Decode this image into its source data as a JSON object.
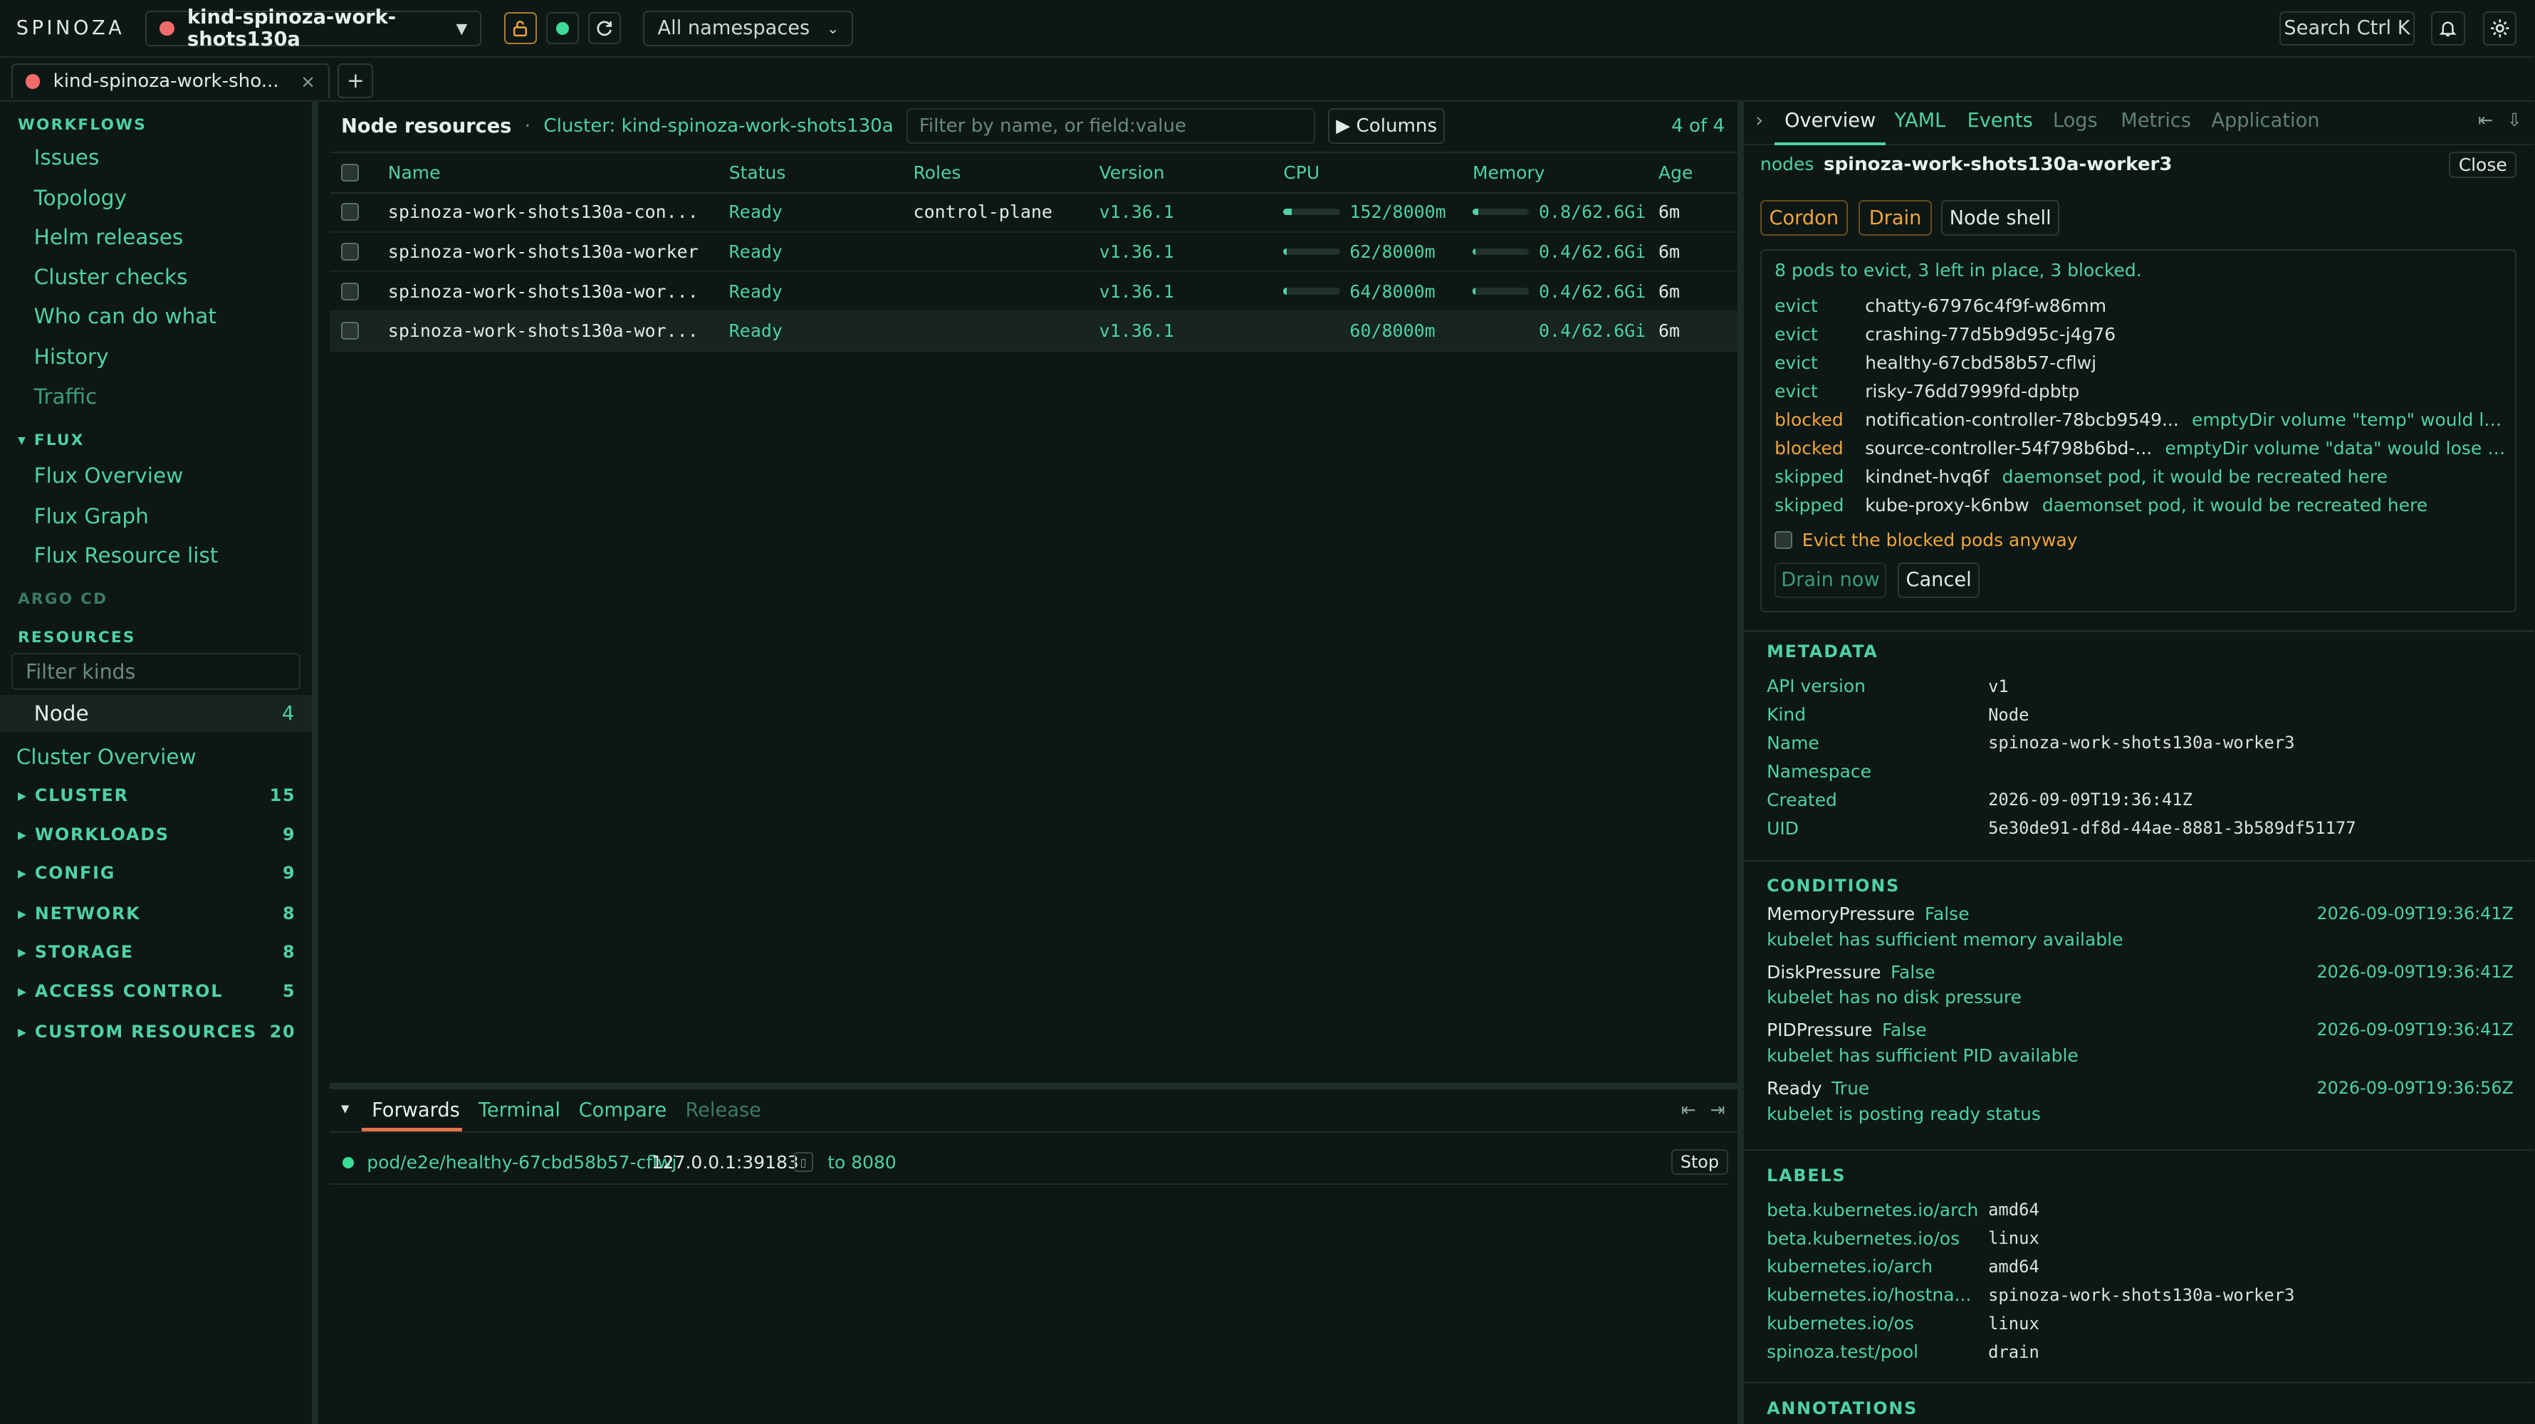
{
  "app": {
    "logo": "SPINOZA",
    "context": "kind-spinoza-work-shots130a",
    "namespace": "All namespaces",
    "search": "Search Ctrl K"
  },
  "tab": {
    "label": "kind-spinoza-work-sho...",
    "close": "×",
    "add": "+"
  },
  "sidebar": {
    "workflows_head": "WORKFLOWS",
    "workflows": [
      "Issues",
      "Topology",
      "Helm releases",
      "Cluster checks",
      "Who can do what",
      "History",
      "Traffic"
    ],
    "flux_head": "▾ FLUX",
    "flux": [
      "Flux Overview",
      "Flux Graph",
      "Flux Resource list"
    ],
    "argo_head": "ARGO CD",
    "resources_head": "RESOURCES",
    "filter_placeholder": "Filter kinds",
    "selected_kind": {
      "label": "Node",
      "count": "4"
    },
    "cluster_overview": "Cluster Overview",
    "groups": [
      {
        "label": "▸ CLUSTER",
        "count": "15"
      },
      {
        "label": "▸ WORKLOADS",
        "count": "9"
      },
      {
        "label": "▸ CONFIG",
        "count": "9"
      },
      {
        "label": "▸ NETWORK",
        "count": "8"
      },
      {
        "label": "▸ STORAGE",
        "count": "8"
      },
      {
        "label": "▸ ACCESS CONTROL",
        "count": "5"
      },
      {
        "label": "▸ CUSTOM RESOURCES",
        "count": "20"
      }
    ]
  },
  "main": {
    "title": "Node resources",
    "sep": "·",
    "cluster": "Cluster: kind-spinoza-work-shots130a",
    "filter_placeholder": "Filter by name, or field:value",
    "columns_btn": "▶ Columns",
    "count": "4 of 4",
    "headers": [
      "Name",
      "Status",
      "Roles",
      "Version",
      "CPU",
      "Memory",
      "Age"
    ],
    "rows": [
      {
        "name": "spinoza-work-shots130a-con...",
        "status": "Ready",
        "roles": "control-plane",
        "version": "v1.36.1",
        "cpu": "152/8000m",
        "cpu_frac": 0.019,
        "mem": "0.8/62.6Gi",
        "mem_frac": 0.013,
        "age": "6m"
      },
      {
        "name": "spinoza-work-shots130a-worker",
        "status": "Ready",
        "roles": "",
        "version": "v1.36.1",
        "cpu": "62/8000m",
        "cpu_frac": 0.008,
        "mem": "0.4/62.6Gi",
        "mem_frac": 0.006,
        "age": "6m"
      },
      {
        "name": "spinoza-work-shots130a-wor...",
        "status": "Ready",
        "roles": "",
        "version": "v1.36.1",
        "cpu": "64/8000m",
        "cpu_frac": 0.008,
        "mem": "0.4/62.6Gi",
        "mem_frac": 0.006,
        "age": "6m"
      },
      {
        "name": "spinoza-work-shots130a-wor...",
        "status": "Ready",
        "roles": "",
        "version": "v1.36.1",
        "cpu": "60/8000m",
        "cpu_frac": 0.008,
        "mem": "0.4/62.6Gi",
        "mem_frac": 0.006,
        "age": "6m"
      }
    ]
  },
  "bottom": {
    "collapse": "▾",
    "tabs": [
      "Forwards",
      "Terminal",
      "Compare",
      "Release"
    ],
    "forward": {
      "target": "pod/e2e/healthy-67cbd58b57-cflwj",
      "local": "127.0.0.1:39183",
      "to": "to 8080",
      "stop": "Stop"
    }
  },
  "right": {
    "collapse": "›",
    "tabs": [
      "Overview",
      "YAML",
      "Events",
      "Logs",
      "Metrics",
      "Application"
    ],
    "kind": "nodes",
    "name": "spinoza-work-shots130a-worker3",
    "close": "Close",
    "actions": [
      "Cordon",
      "Drain",
      "Node shell"
    ],
    "drain": {
      "summary": "8 pods to evict, 3 left in place, 3 blocked.",
      "items": [
        {
          "action": "evict",
          "pod": "chatty-67976c4f9f-w86mm",
          "reason": ""
        },
        {
          "action": "evict",
          "pod": "crashing-77d5b9d95c-j4g76",
          "reason": ""
        },
        {
          "action": "evict",
          "pod": "healthy-67cbd58b57-cflwj",
          "reason": ""
        },
        {
          "action": "evict",
          "pod": "risky-76dd7999fd-dpbtp",
          "reason": ""
        },
        {
          "action": "blocked",
          "pod": "notification-controller-78bcb9549...",
          "reason": "emptyDir volume \"temp\" would los..."
        },
        {
          "action": "blocked",
          "pod": "source-controller-54f798b6bd-...",
          "reason": "emptyDir volume \"data\" would lose it..."
        },
        {
          "action": "skipped",
          "pod": "kindnet-hvq6f",
          "reason": "daemonset pod, it would be recreated here"
        },
        {
          "action": "skipped",
          "pod": "kube-proxy-k6nbw",
          "reason": "daemonset pod, it would be recreated here"
        }
      ],
      "evict_anyway": "Evict the blocked pods anyway",
      "drain_now": "Drain now",
      "cancel": "Cancel"
    },
    "metadata_head": "METADATA",
    "metadata": [
      {
        "k": "API version",
        "v": "v1"
      },
      {
        "k": "Kind",
        "v": "Node"
      },
      {
        "k": "Name",
        "v": "spinoza-work-shots130a-worker3"
      },
      {
        "k": "Namespace",
        "v": ""
      },
      {
        "k": "Created",
        "v": "2026-09-09T19:36:41Z"
      },
      {
        "k": "UID",
        "v": "5e30de91-df8d-44ae-8881-3b589df51177"
      }
    ],
    "conditions_head": "CONDITIONS",
    "conditions": [
      {
        "type": "MemoryPressure",
        "status": "False",
        "time": "2026-09-09T19:36:41Z",
        "msg": "kubelet has sufficient memory available"
      },
      {
        "type": "DiskPressure",
        "status": "False",
        "time": "2026-09-09T19:36:41Z",
        "msg": "kubelet has no disk pressure"
      },
      {
        "type": "PIDPressure",
        "status": "False",
        "time": "2026-09-09T19:36:41Z",
        "msg": "kubelet has sufficient PID available"
      },
      {
        "type": "Ready",
        "status": "True",
        "time": "2026-09-09T19:36:56Z",
        "msg": "kubelet is posting ready status"
      }
    ],
    "labels_head": "LABELS",
    "labels": [
      {
        "k": "beta.kubernetes.io/arch",
        "v": "amd64"
      },
      {
        "k": "beta.kubernetes.io/os",
        "v": "linux"
      },
      {
        "k": "kubernetes.io/arch",
        "v": "amd64"
      },
      {
        "k": "kubernetes.io/hostna...",
        "v": "spinoza-work-shots130a-worker3"
      },
      {
        "k": "kubernetes.io/os",
        "v": "linux"
      },
      {
        "k": "spinoza.test/pool",
        "v": "drain"
      }
    ],
    "annotations_head": "ANNOTATIONS"
  },
  "colors": {
    "accent": "#4fd1a5",
    "warning": "#f0a53c",
    "danger": "#f26b6b",
    "background": "#0d1715"
  }
}
